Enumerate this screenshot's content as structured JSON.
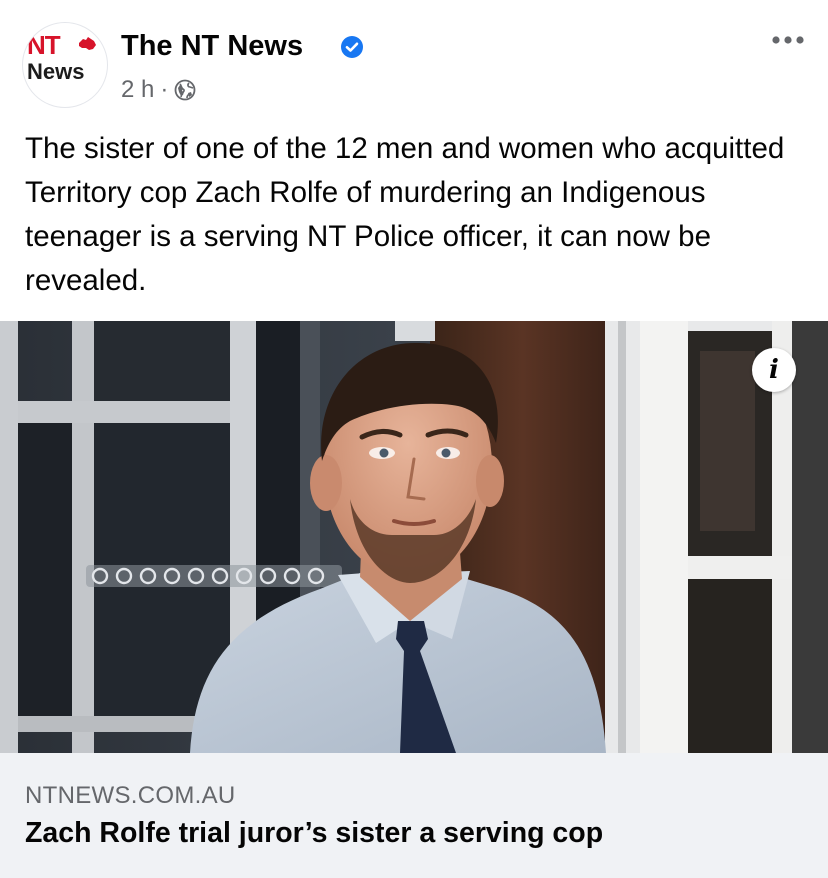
{
  "post": {
    "page_name": "The NT News",
    "logo": {
      "line1": "NT",
      "line2": "News",
      "color": "#d7132a"
    },
    "verified": true,
    "time": "2 h",
    "separator": "·",
    "audience_icon": "globe-icon",
    "menu_icon": "more-options-icon",
    "text": "The sister of one of the 12 men and women who acquitted Territory cop Zach Rolfe of murdering an Indigenous teenager is a serving NT Police officer, it can now be revealed."
  },
  "link_preview": {
    "domain": "NTNEWS.COM.AU",
    "title": "Zach Rolfe trial juror’s sister a serving cop",
    "photo_info_icon": "info-icon",
    "photo_sign": "0000000000"
  },
  "colors": {
    "verified_blue": "#1877f2",
    "secondary_text": "#65676b",
    "preview_bg": "#f0f2f5"
  }
}
